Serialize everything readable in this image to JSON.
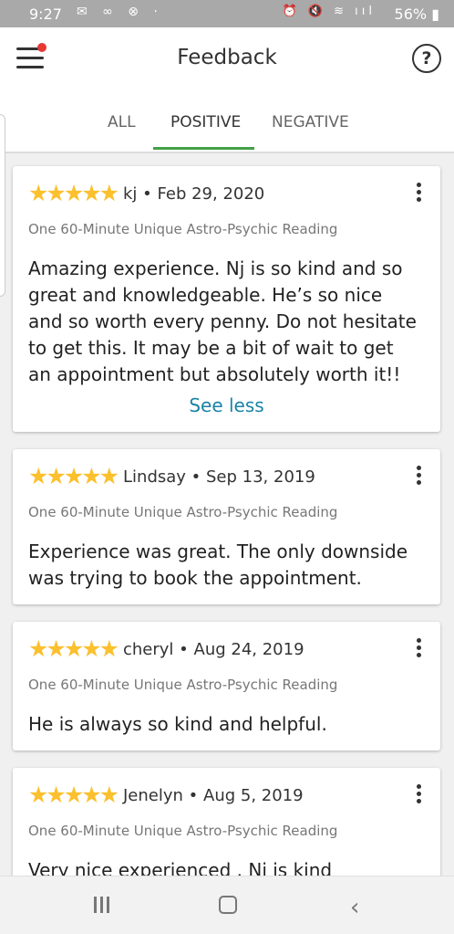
{
  "status_bar": {
    "time": "9:27",
    "left_icons": "✉ ∞ ⊗ ·",
    "right_icons": "⏰ 🔇 ≋ ııl",
    "battery": "56%"
  },
  "header": {
    "title": "Feedback",
    "help_icon": "?"
  },
  "tabs": [
    {
      "label": "ALL"
    },
    {
      "label": "POSITIVE"
    },
    {
      "label": "NEGATIVE"
    }
  ],
  "active_tab": "POSITIVE",
  "accent_color": "#43a047",
  "star_color": "#fbc02d",
  "link_color": "#1a83a6",
  "reviews": [
    {
      "stars": "★★★★★",
      "rating": 5,
      "author": "kj",
      "date": "Feb 29, 2020",
      "product": "One 60-Minute Unique Astro-Psychic Reading",
      "text": "Amazing experience. Nj is so kind and so great and knowledgeable. He’s so nice and so worth every penny. Do not hesitate to get this. It may be a bit of wait to get an appointment but absolutely worth it!!",
      "see_less": "See less"
    },
    {
      "stars": "★★★★★",
      "rating": 5,
      "author": "Lindsay",
      "date": "Sep 13, 2019",
      "product": "One 60-Minute Unique Astro-Psychic Reading",
      "text": "Experience was great. The only downside was trying to book the appointment."
    },
    {
      "stars": "★★★★★",
      "rating": 5,
      "author": "cheryl",
      "date": "Aug 24, 2019",
      "product": "One 60-Minute Unique Astro-Psychic Reading",
      "text": "He is always so kind and helpful."
    },
    {
      "stars": "★★★★★",
      "rating": 5,
      "author": "Jenelyn",
      "date": "Aug 5, 2019",
      "product": "One 60-Minute Unique Astro-Psychic Reading",
      "text": "Very nice experienced . Nj is kind"
    }
  ],
  "nav_bar": {
    "back_icon": "‹"
  }
}
